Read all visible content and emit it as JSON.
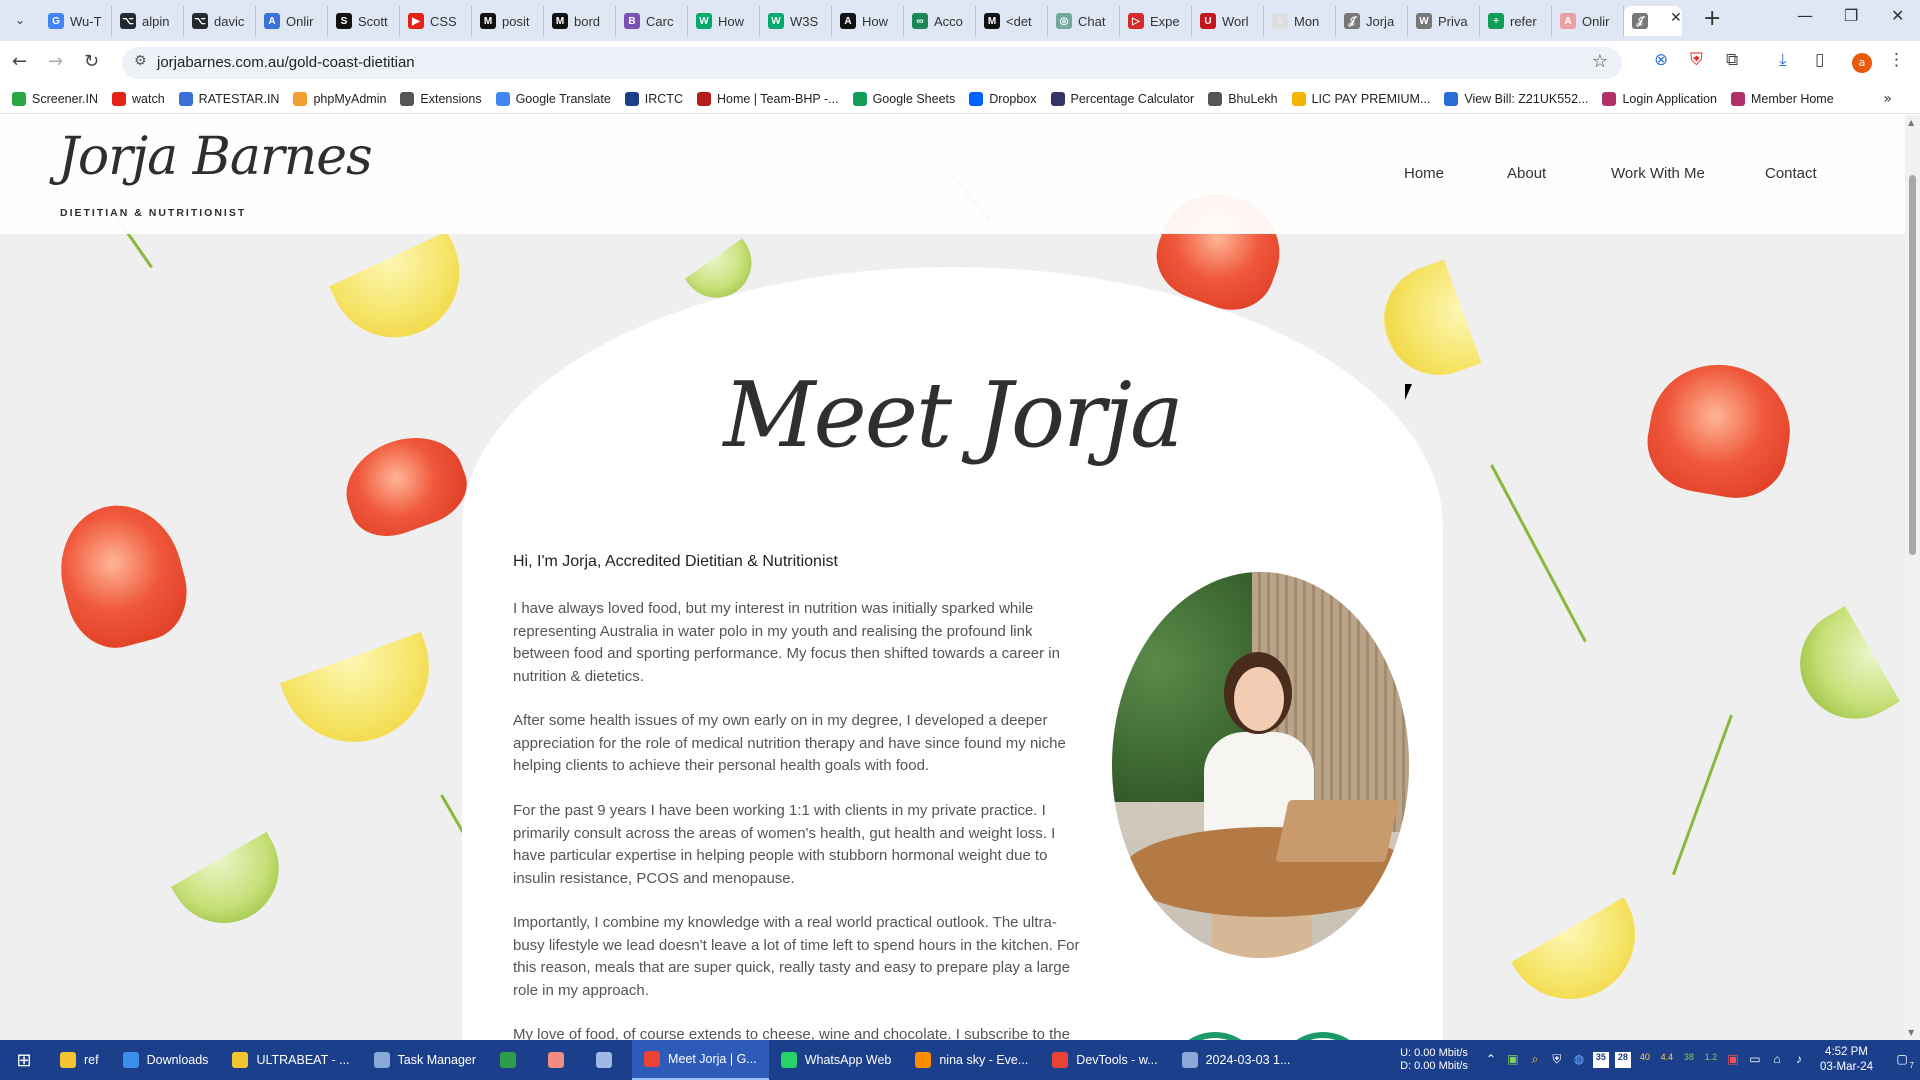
{
  "browser": {
    "tabs": [
      {
        "label": "Wu-T",
        "color": "#4285f4",
        "glyph": "G"
      },
      {
        "label": "alpin",
        "color": "#24292f",
        "glyph": "⌥"
      },
      {
        "label": "davic",
        "color": "#24292f",
        "glyph": "⌥"
      },
      {
        "label": "Onlir",
        "color": "#3b73d9",
        "glyph": "A"
      },
      {
        "label": "Scott",
        "color": "#111111",
        "glyph": "S"
      },
      {
        "label": "CSS",
        "color": "#e62117",
        "glyph": "▶"
      },
      {
        "label": "posit",
        "color": "#111111",
        "glyph": "M"
      },
      {
        "label": "bord",
        "color": "#111111",
        "glyph": "M"
      },
      {
        "label": "Carc",
        "color": "#7952b3",
        "glyph": "B"
      },
      {
        "label": "How",
        "color": "#04aa6d",
        "glyph": "W"
      },
      {
        "label": "W3S",
        "color": "#04aa6d",
        "glyph": "W"
      },
      {
        "label": "How",
        "color": "#111111",
        "glyph": "A"
      },
      {
        "label": "Acco",
        "color": "#1a8754",
        "glyph": "∞"
      },
      {
        "label": "<det",
        "color": "#111111",
        "glyph": "M"
      },
      {
        "label": "Chat",
        "color": "#74aa9c",
        "glyph": "◎"
      },
      {
        "label": "Expe",
        "color": "#d62b2b",
        "glyph": "▷"
      },
      {
        "label": "Worl",
        "color": "#c4161c",
        "glyph": "U"
      },
      {
        "label": "Mon",
        "color": "#dddddd",
        "glyph": "○"
      },
      {
        "label": "Jorja",
        "color": "#777777",
        "glyph": "𝒥"
      },
      {
        "label": "Priva",
        "color": "#777777",
        "glyph": "W"
      },
      {
        "label": "refer",
        "color": "#0f9d58",
        "glyph": "+"
      },
      {
        "label": "Onlir",
        "color": "#e9a1a1",
        "glyph": "A"
      },
      {
        "label": "",
        "color": "#777777",
        "glyph": "𝒥"
      }
    ],
    "url": "jorjabarnes.com.au/gold-coast-dietitian",
    "bookmarks": [
      {
        "label": "Screener.IN",
        "color": "#28a745"
      },
      {
        "label": "watch",
        "color": "#e62117"
      },
      {
        "label": "RATESTAR.IN",
        "color": "#3a6fd8"
      },
      {
        "label": "phpMyAdmin",
        "color": "#f0a030"
      },
      {
        "label": "Extensions",
        "color": "#555555"
      },
      {
        "label": "Google Translate",
        "color": "#4285f4"
      },
      {
        "label": "IRCTC",
        "color": "#1d3f8a"
      },
      {
        "label": "Home | Team-BHP -...",
        "color": "#b71c1c"
      },
      {
        "label": "Google Sheets",
        "color": "#0f9d58"
      },
      {
        "label": "Dropbox",
        "color": "#0061ff"
      },
      {
        "label": "Percentage Calculator",
        "color": "#333366"
      },
      {
        "label": "BhuLekh",
        "color": "#555555"
      },
      {
        "label": "LIC PAY PREMIUM...",
        "color": "#f4b400"
      },
      {
        "label": "View Bill: Z21UK552...",
        "color": "#2b6bd6"
      },
      {
        "label": "Login Application",
        "color": "#b0306a"
      },
      {
        "label": "Member Home",
        "color": "#b0306a"
      }
    ]
  },
  "site": {
    "logo": "Jorja Barnes",
    "logo_sub": "DIETITIAN & NUTRITIONIST",
    "nav": [
      "Home",
      "About",
      "Work With Me",
      "Contact"
    ],
    "heading": "Meet Jorja",
    "intro_title": "Hi, I'm Jorja, Accredited Dietitian & Nutritionist",
    "paragraphs": [
      "I have always loved food, but my interest in nutrition was initially sparked while representing Australia in water polo in my youth and realising the profound link between food and sporting performance. My focus then shifted towards a career in nutrition & dietetics.",
      "After some health issues of my own early on in my degree, I developed a deeper appreciation for the role of medical nutrition therapy and have since found my niche helping clients to achieve their personal health goals with food.",
      "For the past 9 years I have been working 1:1 with clients in my private practice. I primarily consult across the areas of women's health, gut health and weight loss. I have particular expertise in helping people with stubborn hormonal weight due to insulin resistance, PCOS and menopause.",
      "Importantly, I combine my knowledge with a real world practical outlook. The ultra-busy lifestyle we lead doesn't leave a lot of time left to spend hours in the kitchen. For this reason, meals that are super quick, really tasty and easy to prepare play a large role in my approach.",
      "My love of food, of course extends to cheese, wine and chocolate. I subscribe to the"
    ]
  },
  "taskbar": {
    "items": [
      {
        "label": "ref",
        "color": "#f4c430",
        "active": false
      },
      {
        "label": "Downloads",
        "color": "#3b8eea",
        "active": false
      },
      {
        "label": "ULTRABEAT - ...",
        "color": "#f4c430",
        "active": false
      },
      {
        "label": "Task Manager",
        "color": "#8aa8d8",
        "active": false
      },
      {
        "label": "",
        "color": "#2e9d4a",
        "active": false
      },
      {
        "label": "",
        "color": "#f28b82",
        "active": false
      },
      {
        "label": "",
        "color": "#9fb7e8",
        "active": false
      },
      {
        "label": "Meet Jorja | G...",
        "color": "#ea4335",
        "active": true
      },
      {
        "label": "WhatsApp Web",
        "color": "#25d366",
        "active": false
      },
      {
        "label": "nina sky - Eve...",
        "color": "#ff8c00",
        "active": false
      },
      {
        "label": "DevTools - w...",
        "color": "#ea4335",
        "active": false
      },
      {
        "label": "2024-03-03 1...",
        "color": "#8aa8d8",
        "active": false
      }
    ],
    "net_up": "0.00 Mbit/s",
    "net_down": "0.00 Mbit/s",
    "net_u_label": "U:",
    "net_d_label": "D:",
    "tray_numbers": [
      "35",
      "28",
      "40",
      "4.4",
      "38",
      "1.2"
    ],
    "time": "4:52 PM",
    "date": "03-Mar-24",
    "notif": "7"
  }
}
